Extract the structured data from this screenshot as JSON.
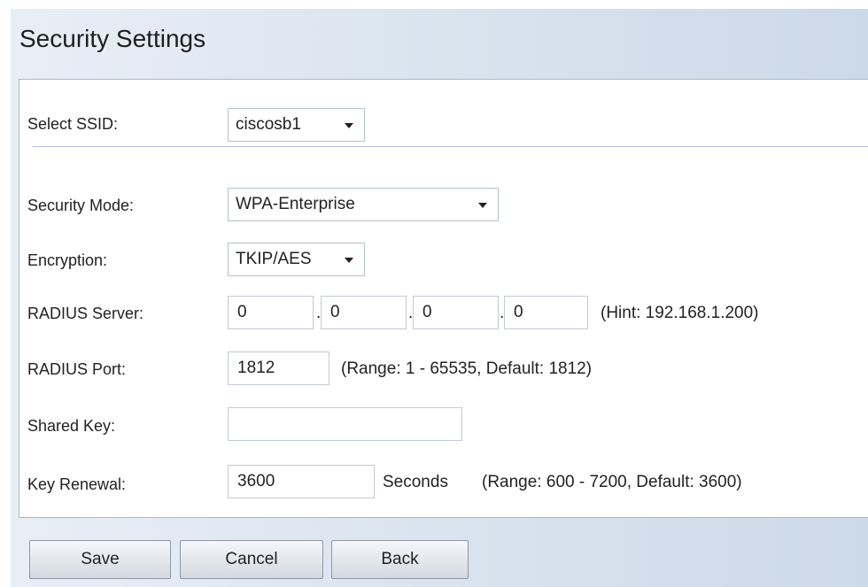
{
  "title": "Security Settings",
  "ssid": {
    "label": "Select SSID:",
    "value": "ciscosb1"
  },
  "security_mode": {
    "label": "Security Mode:",
    "value": "WPA-Enterprise"
  },
  "encryption": {
    "label": "Encryption:",
    "value": "TKIP/AES"
  },
  "radius_server": {
    "label": "RADIUS Server:",
    "octets": [
      "0",
      "0",
      "0",
      "0"
    ],
    "separator": ".",
    "hint": "(Hint: 192.168.1.200)"
  },
  "radius_port": {
    "label": "RADIUS Port:",
    "value": "1812",
    "hint": "(Range: 1 - 65535, Default: 1812)"
  },
  "shared_key": {
    "label": "Shared Key:",
    "value": ""
  },
  "key_renewal": {
    "label": "Key Renewal:",
    "value": "3600",
    "unit": "Seconds",
    "hint": "(Range: 600 - 7200, Default: 3600)"
  },
  "buttons": {
    "save": "Save",
    "cancel": "Cancel",
    "back": "Back"
  },
  "icons": {
    "dropdown": "chevron-down-icon"
  }
}
